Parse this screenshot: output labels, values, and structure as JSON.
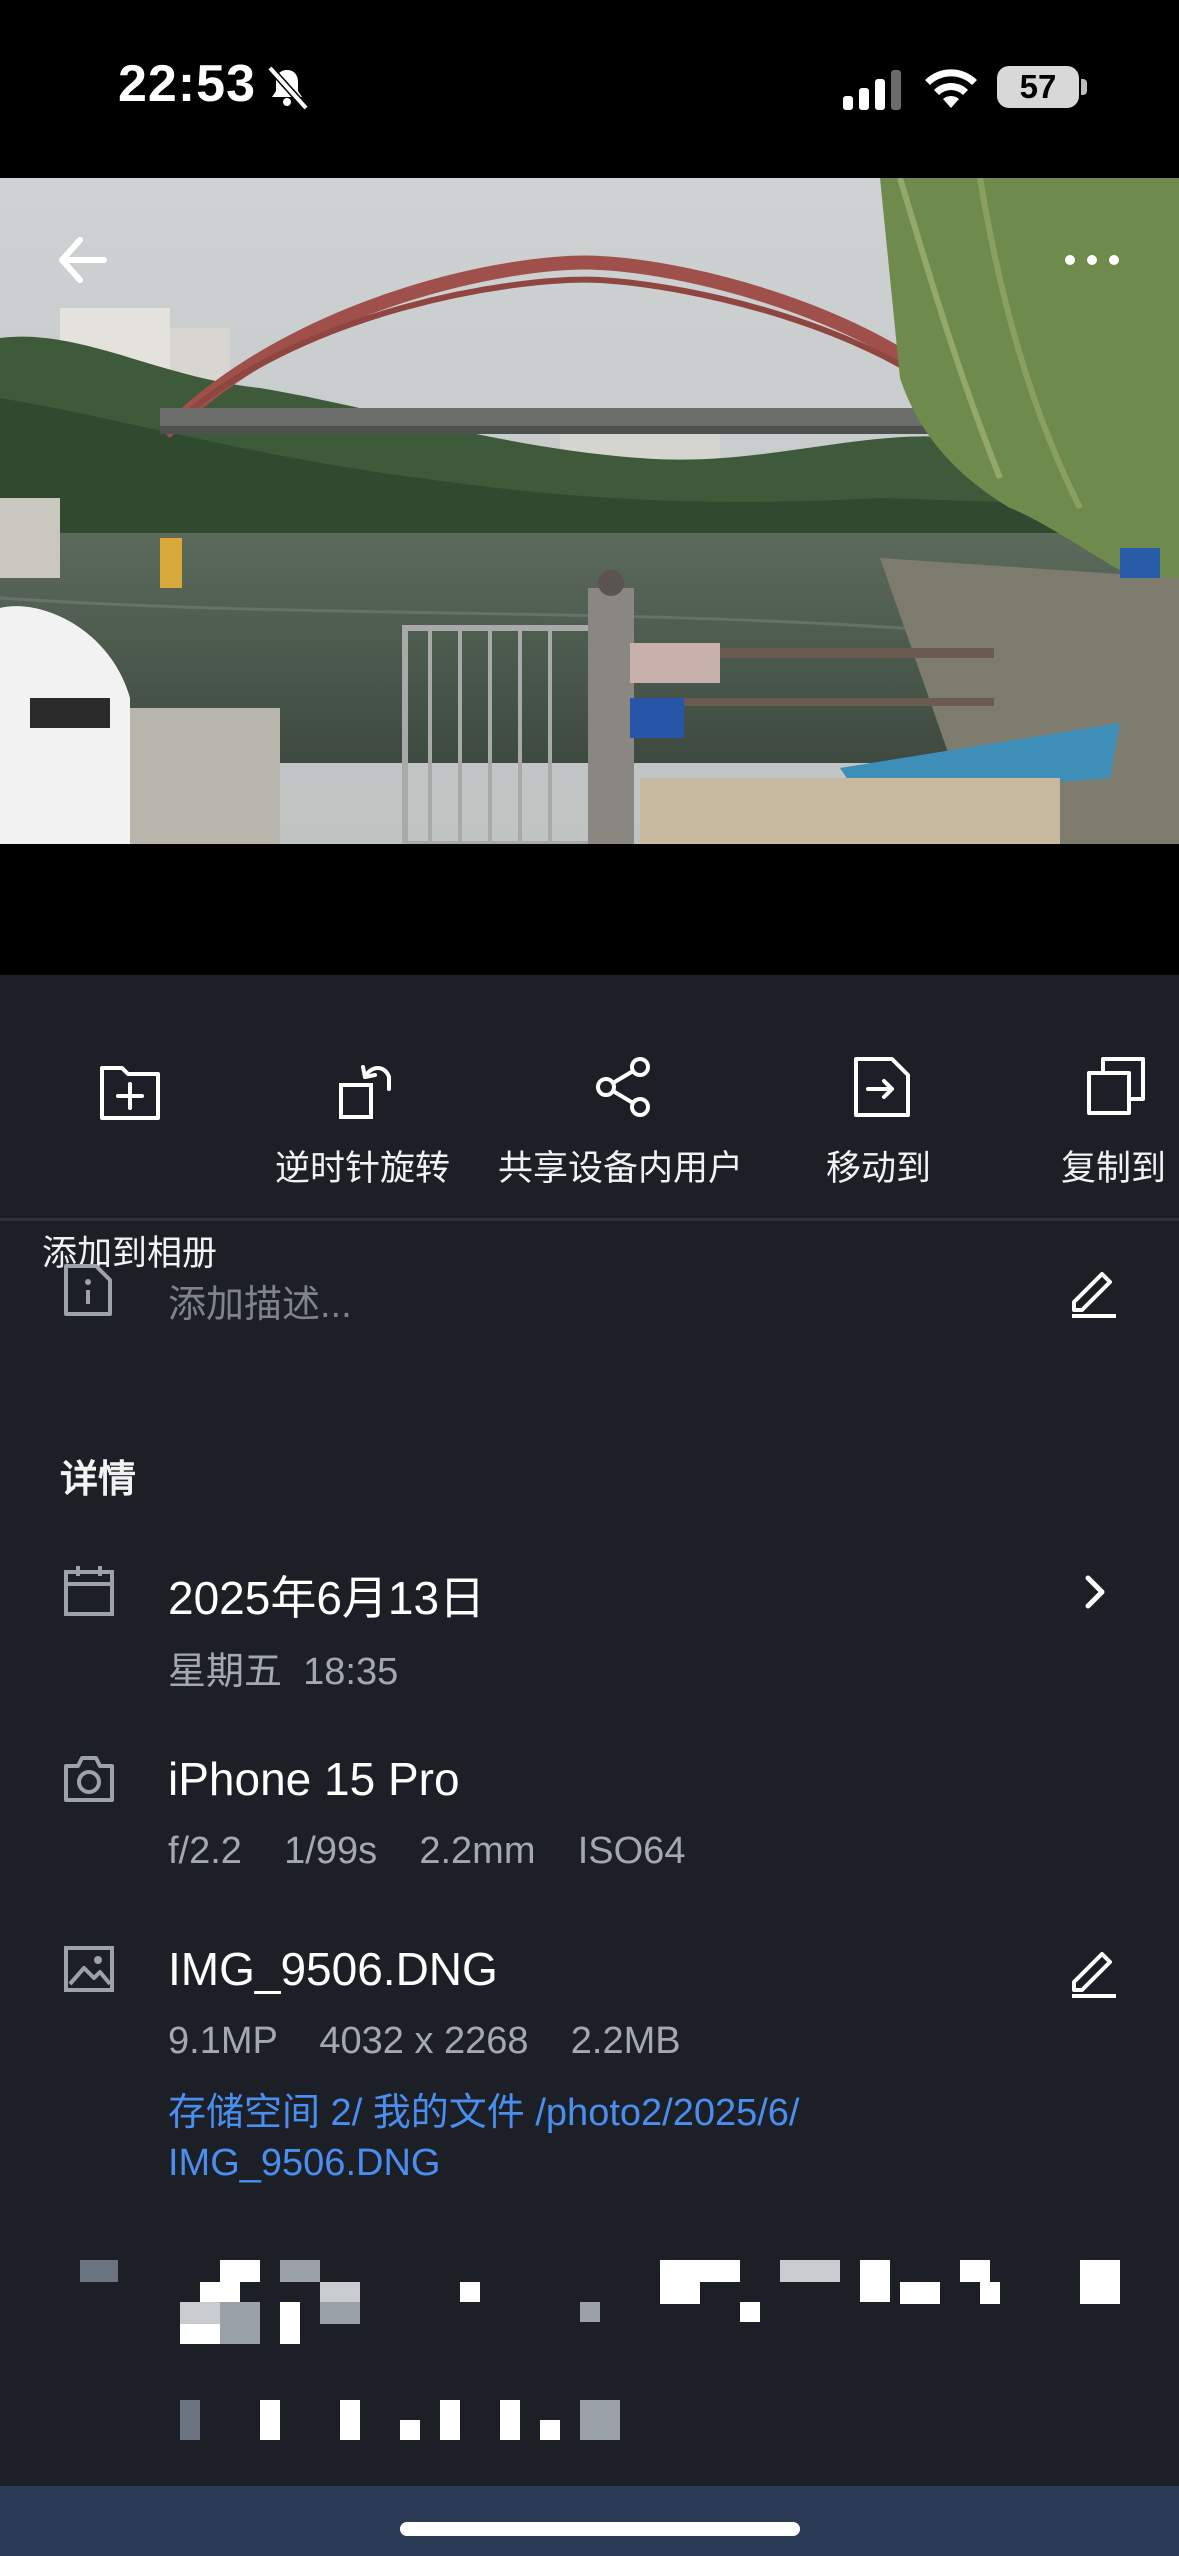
{
  "status_bar": {
    "time": "22:53",
    "battery": "57",
    "icons": [
      "bell-slash-icon",
      "cellular-signal-icon",
      "wifi-icon",
      "battery-icon"
    ]
  },
  "viewer": {
    "back_icon": "arrow-left-icon",
    "more_icon": "more-horizontal-icon"
  },
  "actions": [
    {
      "label": "添加到相册",
      "icon": "folder-plus-icon"
    },
    {
      "label": "逆时针旋转",
      "icon": "rotate-left-icon"
    },
    {
      "label": "共享设备内用户",
      "icon": "share-icon"
    },
    {
      "label": "移动到",
      "icon": "file-move-icon"
    },
    {
      "label": "复制到",
      "icon": "copy-icon"
    }
  ],
  "description": {
    "placeholder": "添加描述...",
    "icon": "info-icon",
    "edit_icon": "edit-icon"
  },
  "details": {
    "title": "详情",
    "date": {
      "title": "2025年6月13日",
      "sub": "星期五  18:35",
      "icon": "calendar-icon",
      "chevron": "chevron-right-icon"
    },
    "camera": {
      "title": "iPhone 15 Pro",
      "sub": "f/2.2    1/99s    2.2mm    ISO64",
      "icon": "camera-icon"
    },
    "file": {
      "title": "IMG_9506.DNG",
      "sub": "9.1MP    4032 x 2268    2.2MB",
      "path_line1": "存储空间 2/ 我的文件 /photo2/2025/6/",
      "path_line2": "IMG_9506.DNG",
      "icon": "image-icon",
      "edit_icon": "edit-icon"
    }
  }
}
